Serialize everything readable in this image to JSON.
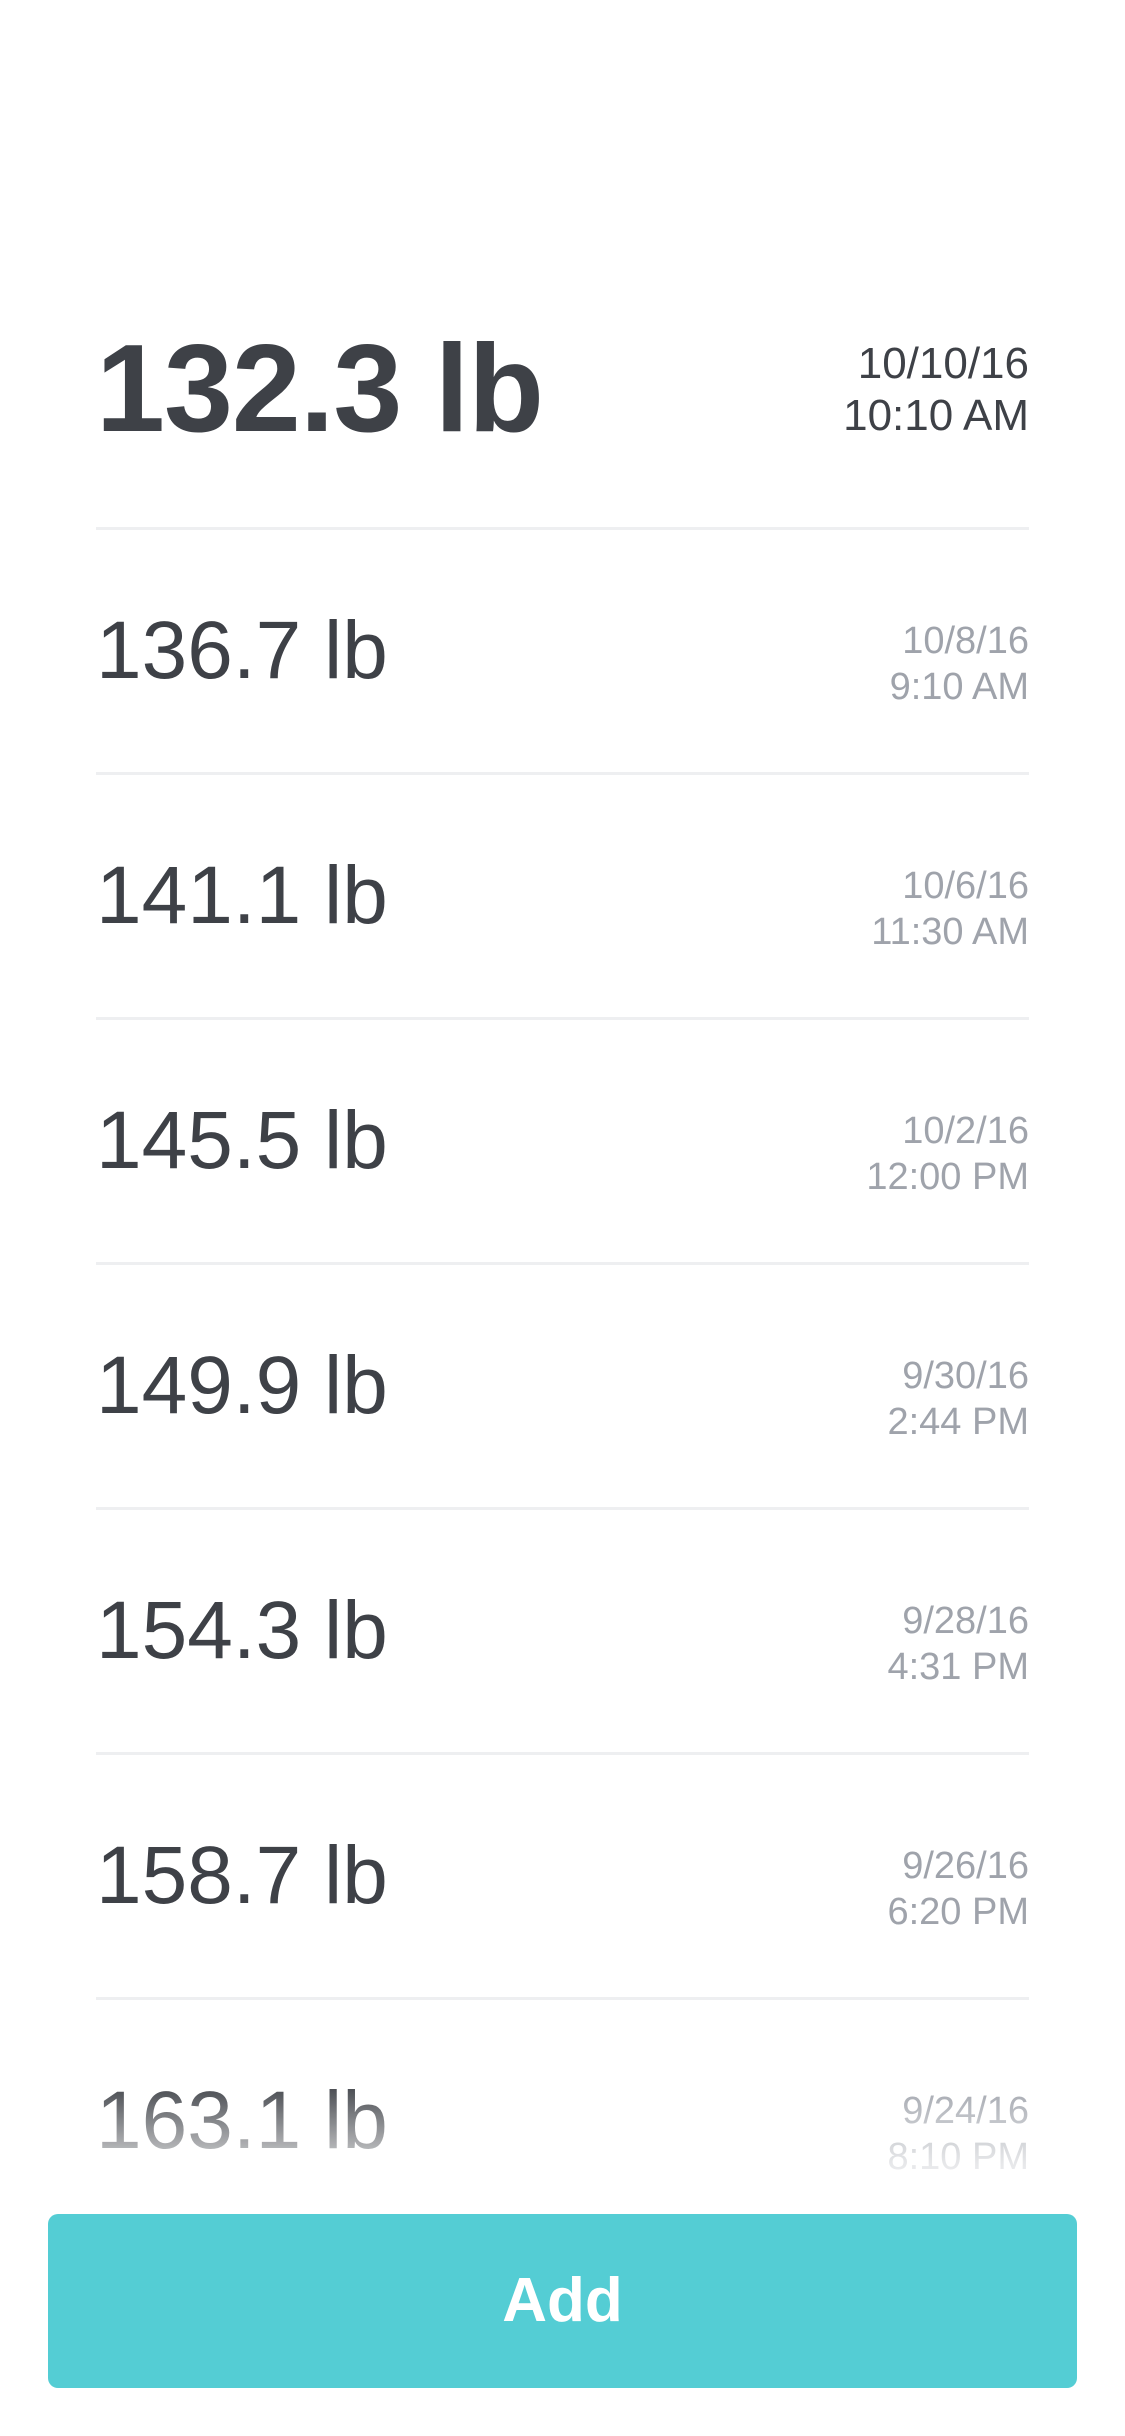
{
  "latest": {
    "weight": "132.3 lb",
    "date": "10/10/16",
    "time": "10:10 AM"
  },
  "entries": [
    {
      "weight": "136.7 lb",
      "date": "10/8/16",
      "time": "9:10 AM"
    },
    {
      "weight": "141.1 lb",
      "date": "10/6/16",
      "time": "11:30 AM"
    },
    {
      "weight": "145.5 lb",
      "date": "10/2/16",
      "time": "12:00 PM"
    },
    {
      "weight": "149.9 lb",
      "date": "9/30/16",
      "time": "2:44 PM"
    },
    {
      "weight": "154.3 lb",
      "date": "9/28/16",
      "time": "4:31 PM"
    },
    {
      "weight": "158.7 lb",
      "date": "9/26/16",
      "time": "6:20 PM"
    },
    {
      "weight": "163.1 lb",
      "date": "9/24/16",
      "time": "8:10 PM"
    }
  ],
  "add_button": {
    "label": "Add",
    "color": "#54cdd4"
  },
  "colors": {
    "primary_text": "#3e4147",
    "secondary_text": "#9fa3ab",
    "divider": "#eeeff1"
  }
}
